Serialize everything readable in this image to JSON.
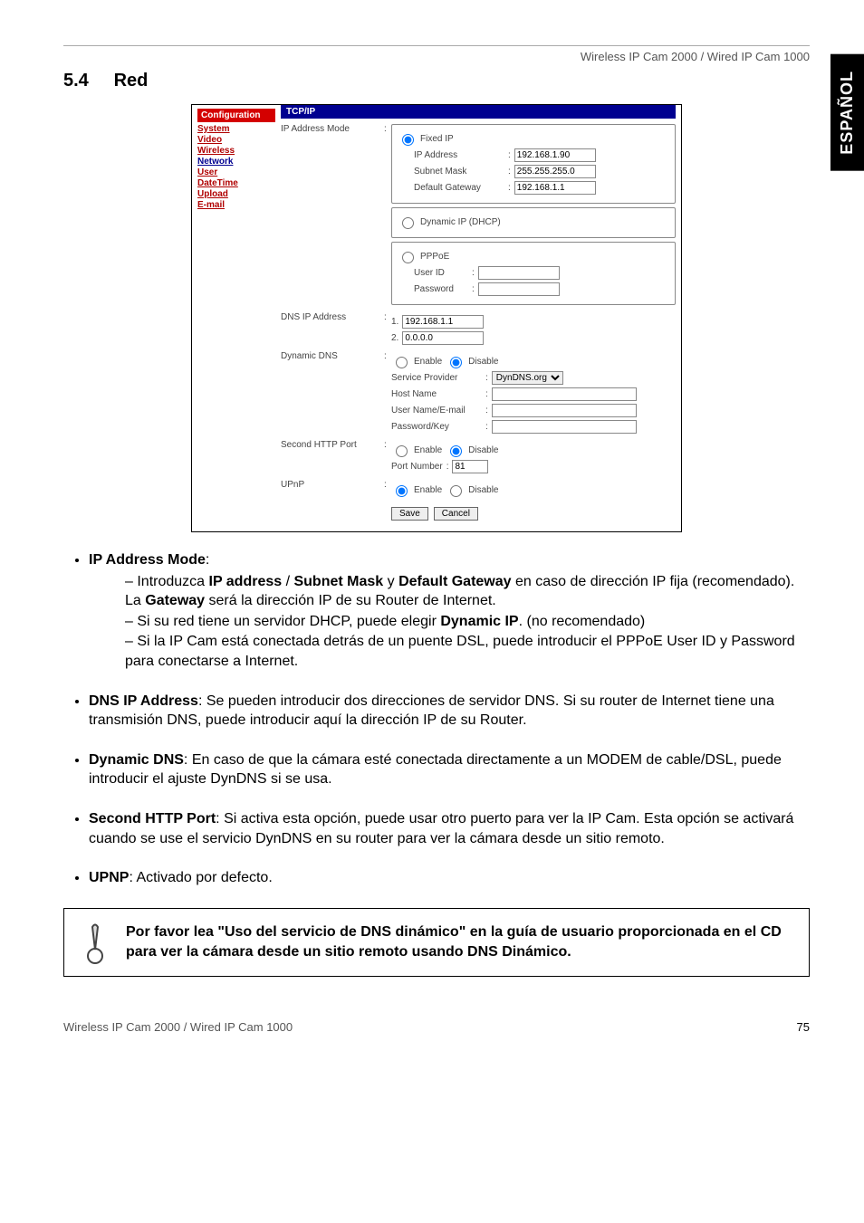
{
  "header": {
    "product_line": "Wireless IP Cam 2000 / Wired IP Cam 1000",
    "side_tab": "ESPAÑOL",
    "section_number": "5.4",
    "section_title": "Red"
  },
  "screenshot": {
    "nav_title": "Configuration",
    "nav_items": [
      "System",
      "Video",
      "Wireless",
      "Network",
      "User",
      "DateTime",
      "Upload",
      "E-mail"
    ],
    "active_nav_index": 3,
    "panel_title": "TCP/IP",
    "ip_mode": {
      "label": "IP Address Mode",
      "fixed": {
        "radio_label": "Fixed IP",
        "ip_label": "IP Address",
        "ip_value": "192.168.1.90",
        "subnet_label": "Subnet Mask",
        "subnet_value": "255.255.255.0",
        "gw_label": "Default Gateway",
        "gw_value": "192.168.1.1"
      },
      "dhcp": {
        "radio_label": "Dynamic IP (DHCP)"
      },
      "pppoe": {
        "radio_label": "PPPoE",
        "user_label": "User ID",
        "user_value": "",
        "pw_label": "Password",
        "pw_value": ""
      }
    },
    "dns": {
      "label": "DNS IP Address",
      "n1": "1.",
      "v1": "192.168.1.1",
      "n2": "2.",
      "v2": "0.0.0.0"
    },
    "dyndns": {
      "label": "Dynamic DNS",
      "enable": "Enable",
      "disable": "Disable",
      "provider_label": "Service Provider",
      "provider_value": "DynDNS.org",
      "host_label": "Host Name",
      "host_value": "",
      "user_label": "User Name/E-mail",
      "user_value": "",
      "key_label": "Password/Key",
      "key_value": ""
    },
    "http": {
      "label": "Second HTTP Port",
      "enable": "Enable",
      "disable": "Disable",
      "port_label": "Port Number",
      "port_value": "81"
    },
    "upnp": {
      "label": "UPnP",
      "enable": "Enable",
      "disable": "Disable"
    },
    "buttons": {
      "save": "Save",
      "cancel": "Cancel"
    }
  },
  "body": {
    "b1_title": "IP Address Mode",
    "b1_sub1_a": "Introduzca ",
    "b1_sub1_b1": "IP address",
    "b1_sub1_s1": " / ",
    "b1_sub1_b2": "Subnet Mask",
    "b1_sub1_s2": " y ",
    "b1_sub1_b3": "Default Gateway",
    "b1_sub1_c": " en caso de dirección IP fija (recomendado). La ",
    "b1_sub1_b4": "Gateway",
    "b1_sub1_d": " será la dirección IP de su Router de Internet.",
    "b1_sub2_a": "Si su red tiene un servidor DHCP, puede elegir ",
    "b1_sub2_b": "Dynamic IP",
    "b1_sub2_c": ". (no recomendado)",
    "b1_sub3": "Si la IP Cam está conectada detrás de un puente DSL, puede introducir el PPPoE User ID y Password para conectarse a Internet.",
    "b2_title": "DNS IP Address",
    "b2_text": ": Se pueden introducir dos direcciones de servidor DNS. Si su router de Internet tiene una transmisión DNS, puede introducir aquí la dirección IP de su Router.",
    "b3_title": "Dynamic DNS",
    "b3_text": ": En caso de que la cámara esté conectada directamente a un MODEM de cable/DSL, puede introducir el ajuste DynDNS si se usa.",
    "b4_title": "Second HTTP Port",
    "b4_text": ": Si activa esta opción, puede usar otro puerto para ver la IP Cam. Esta opción se activará cuando se use el servicio DynDNS en su router para ver la cámara desde un sitio remoto.",
    "b5_title": "UPNP",
    "b5_text": ": Activado por defecto."
  },
  "callout": {
    "text": "Por favor lea \"Uso del servicio de DNS dinámico\" en la guía de usuario proporcionada en el CD para ver la cámara desde un sitio remoto usando DNS Dinámico."
  },
  "footer": {
    "left": "Wireless IP Cam 2000 / Wired IP Cam 1000",
    "page": "75"
  }
}
